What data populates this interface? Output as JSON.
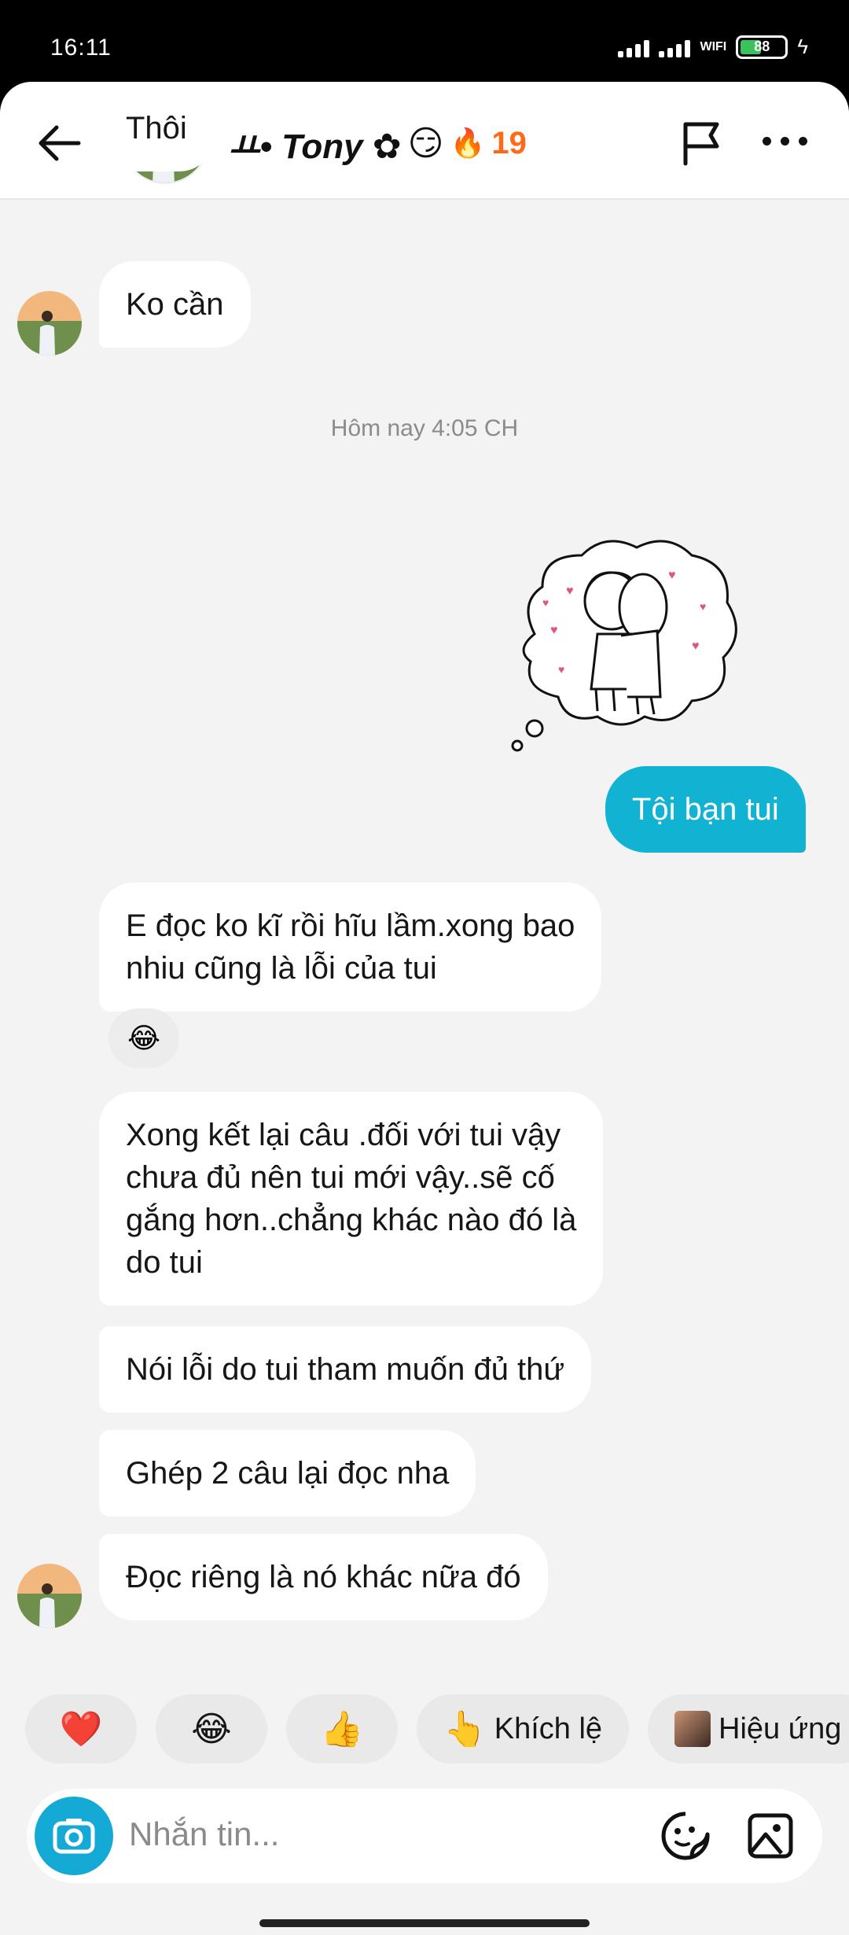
{
  "status_bar": {
    "time": "16:11",
    "wifi_label": "WIFI",
    "battery": "88"
  },
  "header": {
    "contact_name": "ㅛ• Tony ✿",
    "mood_emoji": "😏",
    "streak_icon": "🔥",
    "streak_count": "19"
  },
  "messages": {
    "m0": "Thôi",
    "m1": "Ko cần",
    "timestamp": "Hôm nay 4:05 CH",
    "m2": "Tội bạn tui",
    "m3_line1": "E đọc ko kĩ rồi hĩu lầm.xong bao",
    "m3_line2": "nhiu cũng là lỗi của tui",
    "m3_reaction": "😂",
    "m4_line1": "Xong kết lại câu .đối với tui vậy",
    "m4_line2": "chưa đủ nên tui mới vậy..sẽ cố",
    "m4_line3": "gắng hơn..chẳng khác nào đó là",
    "m4_line4": "do tui",
    "m5": "Nói lỗi do tui tham muốn đủ thứ",
    "m6": "Ghép 2 câu lại đọc nha",
    "m7": "Đọc riêng là nó khác nữa đó"
  },
  "quick_replies": {
    "heart": "❤️",
    "laugh": "😂",
    "thumbs": "👍",
    "encourage_emoji": "👆",
    "encourage_label": "Khích lệ",
    "effects_label": "Hiệu ứng"
  },
  "composer": {
    "placeholder": "Nhắn tin..."
  },
  "colors": {
    "outgoing_bubble": "#12b3d2",
    "camera_button": "#15aad6",
    "streak": "#ff6a1a"
  }
}
